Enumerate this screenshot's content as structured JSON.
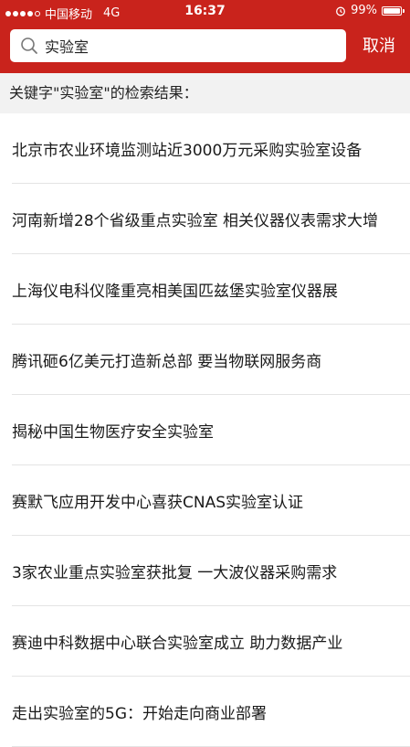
{
  "status_bar": {
    "carrier": "中国移动",
    "network": "4G",
    "time": "16:37",
    "battery": "99%",
    "battery_level": 0.99,
    "signal_bars": 4
  },
  "search": {
    "value": "实验室",
    "cancel_label": "取消"
  },
  "results": {
    "header": "关键字\"实验室\"的检索结果：",
    "items": [
      {
        "title": "北京市农业环境监测站近3000万元采购实验室设备"
      },
      {
        "title": "河南新增28个省级重点实验室 相关仪器仪表需求大增"
      },
      {
        "title": "上海仪电科仪隆重亮相美国匹兹堡实验室仪器展"
      },
      {
        "title": "腾讯砸6亿美元打造新总部 要当物联网服务商"
      },
      {
        "title": "揭秘中国生物医疗安全实验室"
      },
      {
        "title": "赛默飞应用开发中心喜获CNAS实验室认证"
      },
      {
        "title": "3家农业重点实验室获批复 一大波仪器采购需求"
      },
      {
        "title": "赛迪中科数据中心联合实验室成立 助力数据产业"
      },
      {
        "title": "走出实验室的5G：开始走向商业部署"
      }
    ]
  },
  "colors": {
    "brand_red": "#c9231c",
    "header_bg": "#f2f2f2",
    "divider": "#e4e4e4"
  },
  "icons": {
    "search": "search-icon",
    "alarm": "alarm-icon",
    "battery": "battery-icon",
    "signal": "signal-icon"
  }
}
